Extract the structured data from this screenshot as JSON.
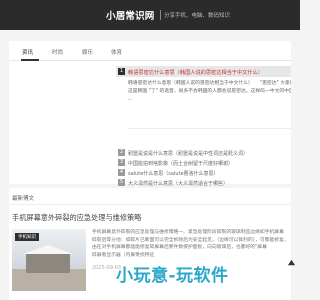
{
  "header": {
    "brand": "小居常识网",
    "tagline": "分享手机、电脑、数码知识"
  },
  "tabs": [
    {
      "label": "资讯"
    },
    {
      "label": "时尚"
    },
    {
      "label": "娱乐"
    },
    {
      "label": "体育"
    }
  ],
  "featured": {
    "number": "1",
    "title": "韩语思密达什么意思（韩国人说的思密达相当于中文什么）",
    "description": [
      "韩语思密达什么意思（韩国人说的思密达相当于中文什么）　　\"思密达\" 大家都经过吧,",
      "这是韩国 \"了\" 的谐音，很多不会韩国的人都会说思密达。这样吗一中文的中国",
      "..."
    ]
  },
  "list": [
    {
      "number": "2",
      "text": "耐噩是说是什么意思（耐噩是说是中性词还是贬义词）"
    },
    {
      "number": "3",
      "text": "中国能拍到啥影像（而土合树留于尺度好哪谢）"
    },
    {
      "number": "4",
      "text": "salute什么意思（salute曹洛什么意思）"
    },
    {
      "number": "5",
      "text": "大义凛然是什么意思（大义凛然适合于哪些）"
    }
  ],
  "section": {
    "label": "最新博文"
  },
  "article": {
    "title": "手机屏幕意外碎裂的应急处理与维修策略",
    "tag": "手机知识",
    "excerpt": [
      "手机屏幕意外碎裂的应急处理与维修策略一、紧急处理阶段碎裂的玻璃制品边缘如手机屏幕",
      "碎裂后等分地：如碎片已断面可以完全拆除后为安全起见，（边缘可以锋利的），可都能修复，",
      "由在对手机屏幕都能能修复碎屏幕后要件数保护面板，向向玻璃后，也都好的\"屏幕",
      "碎屏看显示器（内屏受损特征"
    ],
    "date": "2025-09-03"
  },
  "watermark": "小玩意-玩软件"
}
